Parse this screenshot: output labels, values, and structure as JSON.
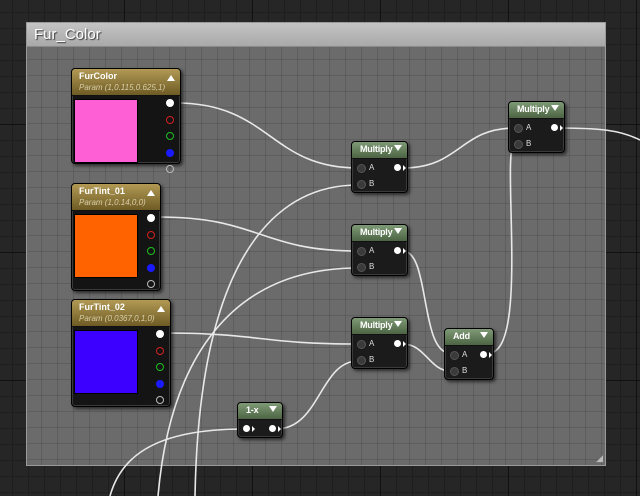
{
  "comment": {
    "title": "Fur_Color"
  },
  "params": [
    {
      "id": "fur-color",
      "title": "FurColor",
      "subtitle": "Param (1,0.115,0.625,1)",
      "color": "#ff5fd4"
    },
    {
      "id": "fur-tint-01",
      "title": "FurTint_01",
      "subtitle": "Param (1,0.14,0,0)",
      "color": "#ff6300"
    },
    {
      "id": "fur-tint-02",
      "title": "FurTint_02",
      "subtitle": "Param (0.0367,0,1,0)",
      "color": "#3b00ff"
    }
  ],
  "nodes": {
    "multiply1": {
      "title": "Multiply",
      "a": "A",
      "b": "B"
    },
    "multiply2": {
      "title": "Multiply",
      "a": "A",
      "b": "B"
    },
    "multiply3": {
      "title": "Multiply",
      "a": "A",
      "b": "B"
    },
    "multiply_top": {
      "title": "Multiply",
      "a": "A",
      "b": "B"
    },
    "add": {
      "title": "Add",
      "a": "A",
      "b": "B"
    },
    "one_minus": {
      "title": "1-x"
    }
  },
  "pin_colors": {
    "white": "#ffffff",
    "red": "#d42020",
    "green": "#20c020",
    "blue": "#1a1aff",
    "alpha": "#bbbbbb"
  }
}
